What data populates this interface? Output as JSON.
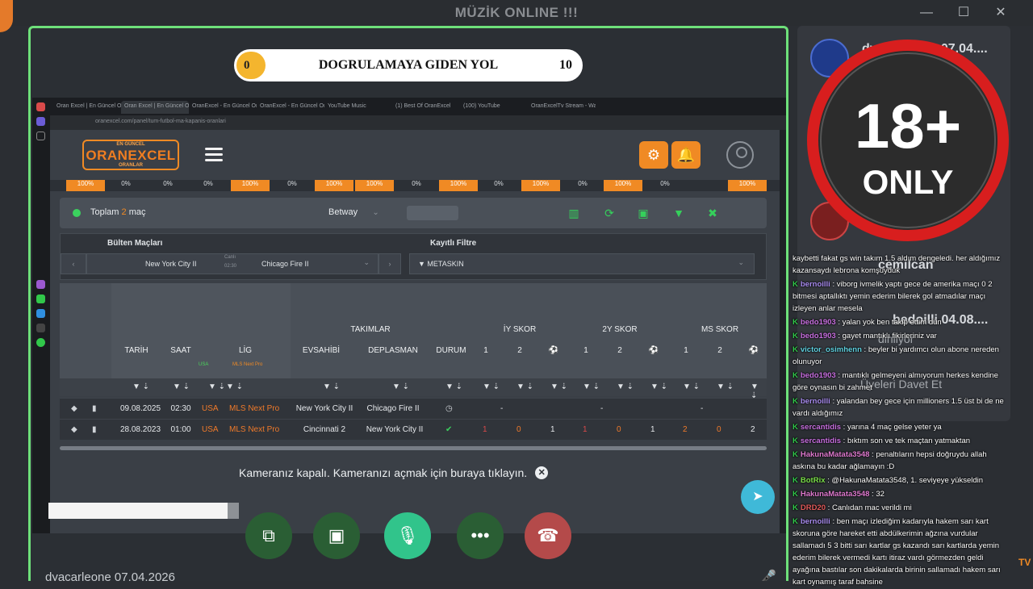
{
  "window": {
    "title": "MÜZİK ONLINE !!!",
    "minimize": "—",
    "maximize": "☐",
    "close": "✕"
  },
  "progress": {
    "start": "0",
    "title": "DOGRULAMAYA GIDEN YOL",
    "end": "10",
    "fraction": 0.0
  },
  "browser": {
    "tabs": [
      "Oran Excel | En Güncel Oranlar",
      "Oran Excel | En Güncel Oranlar",
      "OranExcel - En Güncel Oranlar",
      "OranExcel - En Güncel Oranlar",
      "YouTube Music",
      "(1) Best Of OranExcel",
      "(100) YouTube",
      "OranExcelTv Stream - Wall"
    ],
    "url": "oranexcel.com/panel/tum-futbol-ma-kapanis-oranlari"
  },
  "site": {
    "logo_top": "EN GÜNCEL",
    "logo_main": "ORANEXCEL",
    "logo_sub": "ORANLAR",
    "pc_cells": [
      "100%",
      "0%",
      "0%",
      "0%",
      "100%",
      "0%",
      "100%",
      "100%",
      "0%",
      "100%",
      "0%",
      "100%",
      "0%",
      "100%",
      "0%",
      "100%"
    ],
    "total_label": "Toplam",
    "total_count": "2",
    "total_unit": "maç",
    "bookmaker": "Betway",
    "filter": {
      "bulten_label": "Bülten Maçları",
      "bulten_home": "New York City II",
      "bulten_time_top": "Canlı",
      "bulten_time": "02:30",
      "bulten_away": "Chicago Fire II",
      "kayitli_label": "Kayıtlı Filtre",
      "kayitli_value": "METASKIN"
    },
    "headers": {
      "takimlar": "TAKIMLAR",
      "iy": "İY SKOR",
      "2y": "2Y SKOR",
      "ms": "MS SKOR",
      "tarih": "TARİH",
      "saat": "SAAT",
      "lig": "LİG",
      "ev": "EVSAHİBİ",
      "dep": "DEPLASMAN",
      "durum": "DURUM",
      "n1": "1",
      "n2": "2",
      "lig_sub1": "USA",
      "lig_sub2": "MLS Next Pro"
    },
    "rows": [
      {
        "tarih": "09.08.2025",
        "saat": "02:30",
        "ulke": "USA",
        "lig": "MLS Next Pro",
        "ev": "New York City II",
        "dep": "Chicago Fire II",
        "durum": "◷",
        "iy": "-",
        "y2": "-",
        "ms": "-"
      },
      {
        "tarih": "28.08.2023",
        "saat": "01:00",
        "ulke": "USA",
        "lig": "MLS Next Pro",
        "ev": "Cincinnati 2",
        "dep": "New York City II",
        "durum": "✔",
        "iy1": "1",
        "iy2": "0",
        "iy3": "1",
        "y21": "1",
        "y22": "0",
        "y23": "1",
        "ms1": "2",
        "ms2": "0",
        "ms3": "2"
      }
    ]
  },
  "call": {
    "camera_notice": "Kameranız kapalı. Kameranızı açmak için buraya tıklayın.",
    "username": "dyacarleone 07.04.2026"
  },
  "right_panel": {
    "user1": "dyacarleone 07.04....",
    "user2": "cemilcan",
    "user3": "bedoilli 04.08....",
    "user4": "dinliyor",
    "invite": "Üyeleri Davet Et",
    "badge_top": "18+",
    "badge_bottom": "ONLY"
  },
  "chat": [
    {
      "user": "",
      "text": "kaybetti fakat gs win takım 1.5 aldım dengeledi. her aldığımız kazansaydı lebrona komşuyduk",
      "color": "#ffffff"
    },
    {
      "user": "bernoilli",
      "text": "viborg ivmelik yaptı gece de amerika maçı 0 2 bitmesi aptallıktı yemin ederim bilerek gol atmadılar maçı izleyen anlar mesela",
      "color": "#a98cf0"
    },
    {
      "user": "bedo1903",
      "text": "yalan yok ben takip ettim dün",
      "color": "#c86fe0"
    },
    {
      "user": "bedo1903",
      "text": "gayet mantıklı fikirleriniz var",
      "color": "#c86fe0"
    },
    {
      "user": "victor_osimhenn",
      "text": "beyler bi yardımcı olun abone nereden olunuyor",
      "color": "#5fd1e0"
    },
    {
      "user": "bedo1903",
      "text": "mantıklı gelmeyeni almıyorum herkes kendine göre oynasın bi zahmet",
      "color": "#c86fe0"
    },
    {
      "user": "bernoilli",
      "text": "yalandan bey gece için millioners 1.5 üst bi de ne vardı aldığımız",
      "color": "#a98cf0"
    },
    {
      "user": "sercantidis",
      "text": "yarına 4 maç gelse yeter ya",
      "color": "#c86fe0"
    },
    {
      "user": "sercantidis",
      "text": "bıktım son ve tek maçtan yatmaktan",
      "color": "#c86fe0"
    },
    {
      "user": "HakunaMatata3548",
      "text": "penaltıların hepsi doğruydu allah askına bu kadar ağlamayın :D",
      "color": "#e07ad0"
    },
    {
      "user": "BotRix",
      "text": "@HakunaMatata3548, 1. seviyeye yükseldin",
      "color": "#7be04a"
    },
    {
      "user": "HakunaMatata3548",
      "text": "32",
      "color": "#e07ad0"
    },
    {
      "user": "DRD20",
      "text": "Canlıdan mac verildi mi",
      "color": "#e05a5a"
    },
    {
      "user": "bernoilli",
      "text": "ben maçı izlediğim kadarıyla hakem sarı kart skoruna göre hareket etti abdülkerimin ağzına vurdular sallamadı 5 3 bitti sarı kartlar gs kazandı sarı kartlarda yemin ederim bilerek vermedi kartı itiraz vardı görmezden geldi ayağına bastılar son dakikalarda birinin sallamadı hakem sarı kart oynamış taraf bahsine",
      "color": "#a98cf0"
    }
  ]
}
